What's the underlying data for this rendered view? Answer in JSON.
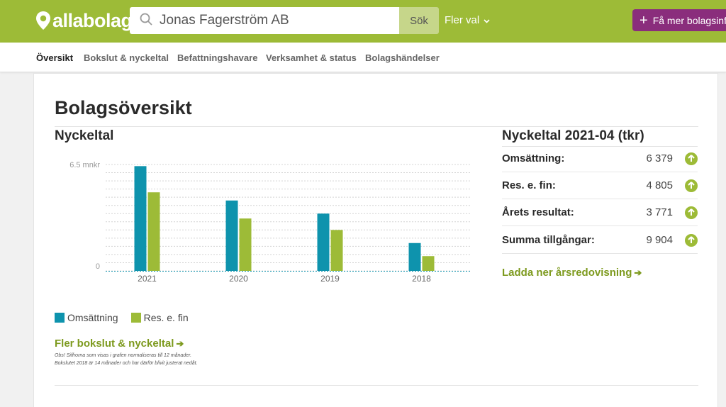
{
  "header": {
    "logo_text": "allabolag",
    "search_value": "Jonas Fagerström AB",
    "search_button": "Sök",
    "more_options": "Fler val",
    "cta_label": "Få mer bolagsinfo",
    "brand_color": "#9dbb37",
    "cta_color": "#8a2d7c"
  },
  "subnav": {
    "items": [
      "Översikt",
      "Bokslut & nyckeltal",
      "Befattningshavare",
      "Verksamhet & status",
      "Bolagshändelser"
    ],
    "active": "Översikt"
  },
  "page": {
    "title": "Bolagsöversikt",
    "chart_title": "Nyckeltal",
    "figures_title": "Nyckeltal 2021-04 (tkr)",
    "more_link": "Fler bokslut & nyckeltal",
    "note_line1": "Obs! Siffrorna som visas i grafen normaliseras till 12 månader.",
    "note_line2": "Bokslutet 2018 är 14 månader och har därför blivit justerat nedåt.",
    "download_link": "Ladda ner årsredovisning"
  },
  "key_figures": [
    {
      "label": "Omsättning:",
      "value": "6 379",
      "icon": "arrow-up-icon"
    },
    {
      "label": "Res. e. fin:",
      "value": "4 805",
      "icon": "arrow-up-icon"
    },
    {
      "label": "Årets resultat:",
      "value": "3 771",
      "icon": "arrow-up-icon"
    },
    {
      "label": "Summa tillgångar:",
      "value": "9 904",
      "icon": "arrow-up-icon"
    }
  ],
  "chart_data": {
    "type": "bar",
    "categories": [
      "2021",
      "2020",
      "2019",
      "2018"
    ],
    "series": [
      {
        "name": "Omsättning",
        "color": "#0e93ad",
        "values": [
          6.4,
          4.3,
          3.5,
          1.7
        ]
      },
      {
        "name": "Res. e. fin",
        "color": "#9dbb37",
        "values": [
          4.8,
          3.2,
          2.5,
          0.9
        ]
      }
    ],
    "ytick_labels": [
      "6.5 mnkr",
      "0"
    ],
    "ylim": [
      0,
      6.5
    ],
    "grid": true,
    "legend": "bottom-left"
  }
}
